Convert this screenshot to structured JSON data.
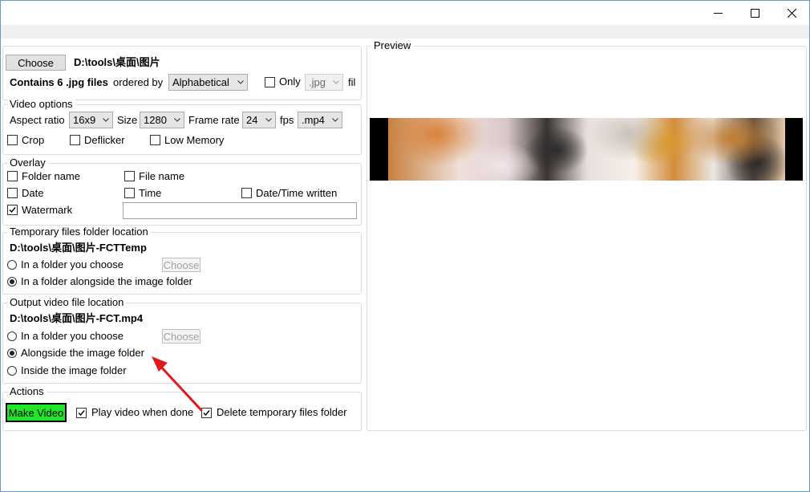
{
  "window": {
    "controls": {
      "minimize": "minimize-icon",
      "maximize": "maximize-icon",
      "close": "close-icon"
    }
  },
  "images": {
    "choose_label": "Choose",
    "folder_path": "D:\\tools\\桌面\\图片",
    "contains_text": "Contains 6 .jpg files",
    "ordered_by_label": "ordered by",
    "order_value": "Alphabetical",
    "only_label": "Only",
    "only_checked": false,
    "ext_value": ".jpg",
    "fil_label": "fil"
  },
  "video_options": {
    "title": "Video options",
    "aspect_label": "Aspect ratio",
    "aspect_value": "16x9",
    "size_label": "Size",
    "size_value": "1280",
    "framerate_label": "Frame rate",
    "framerate_value": "24",
    "fps_label": "fps",
    "format_value": ".mp4",
    "crop_label": "Crop",
    "deflicker_label": "Deflicker",
    "lowmem_label": "Low Memory"
  },
  "overlay": {
    "title": "Overlay",
    "folder_name_label": "Folder name",
    "file_name_label": "File name",
    "date_label": "Date",
    "time_label": "Time",
    "datetime_written_label": "Date/Time written",
    "watermark_label": "Watermark",
    "watermark_checked": true,
    "watermark_value": ""
  },
  "temp_folder": {
    "title": "Temporary files folder location",
    "path": "D:\\tools\\桌面\\图片-FCTTemp",
    "option_choose_label": "In a folder you choose",
    "choose_label": "Choose",
    "option_alongside_label": "In a folder alongside the image folder",
    "selected": "alongside"
  },
  "output": {
    "title": "Output video file location",
    "path": "D:\\tools\\桌面\\图片-FCT.mp4",
    "option_choose_label": "In a folder you choose",
    "choose_label": "Choose",
    "option_alongside_label": "Alongside the image folder",
    "option_inside_label": "Inside the image folder",
    "selected": "alongside"
  },
  "actions": {
    "title": "Actions",
    "make_video_label": "Make Video",
    "play_label": "Play video when done",
    "play_checked": true,
    "delete_label": "Delete temporary files folder",
    "delete_checked": true
  },
  "preview": {
    "title": "Preview"
  },
  "colors": {
    "make_video_bg": "#22e62a",
    "annotation_arrow": "#e0191e"
  }
}
